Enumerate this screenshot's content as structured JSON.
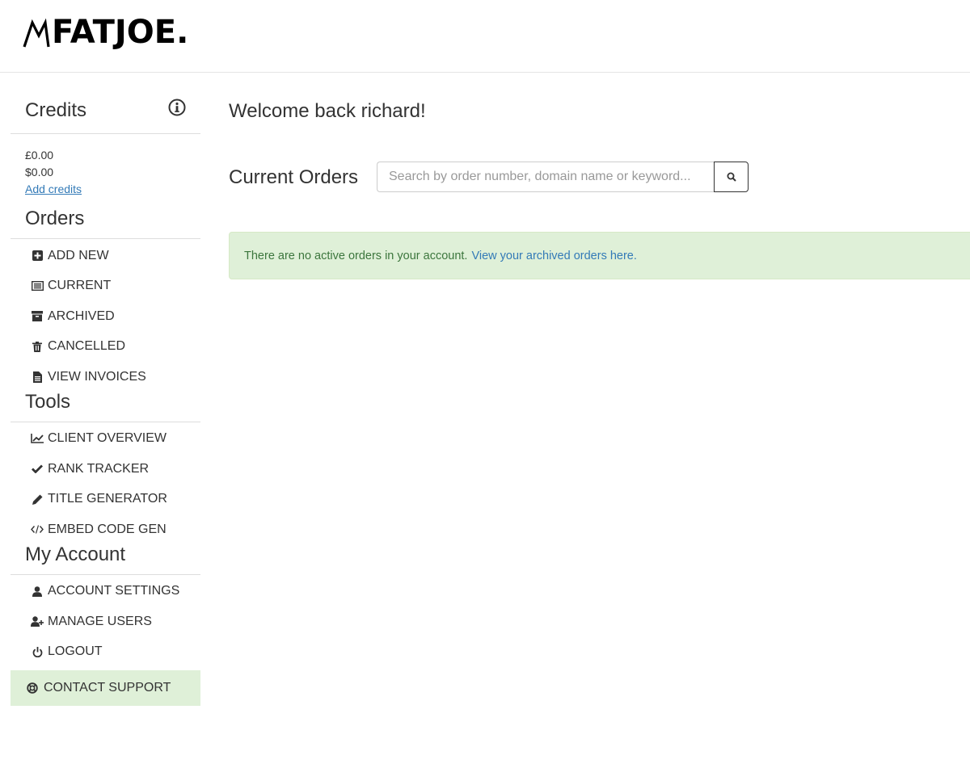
{
  "brand": {
    "logo_text": "FATJOE."
  },
  "credits": {
    "title": "Credits",
    "info_icon": "info-circle-icon",
    "gbp": "£0.00",
    "usd": "$0.00",
    "add_link": "Add credits"
  },
  "orders": {
    "title": "Orders",
    "items": [
      {
        "label": "ADD NEW",
        "icon": "plus-square-icon"
      },
      {
        "label": "CURRENT",
        "icon": "list-alt-icon"
      },
      {
        "label": "ARCHIVED",
        "icon": "archive-icon"
      },
      {
        "label": "CANCELLED",
        "icon": "trash-icon"
      },
      {
        "label": "VIEW INVOICES",
        "icon": "file-text-icon"
      }
    ]
  },
  "tools": {
    "title": "Tools",
    "items": [
      {
        "label": "CLIENT OVERVIEW",
        "icon": "line-chart-icon"
      },
      {
        "label": "RANK TRACKER",
        "icon": "check-icon"
      },
      {
        "label": "TITLE GENERATOR",
        "icon": "pencil-icon"
      },
      {
        "label": "EMBED CODE GEN",
        "icon": "code-icon"
      }
    ]
  },
  "account": {
    "title": "My Account",
    "items": [
      {
        "label": "ACCOUNT SETTINGS",
        "icon": "user-icon"
      },
      {
        "label": "MANAGE USERS",
        "icon": "user-plus-icon"
      },
      {
        "label": "LOGOUT",
        "icon": "power-off-icon"
      }
    ]
  },
  "support": {
    "label": "CONTACT SUPPORT",
    "icon": "life-ring-icon"
  },
  "main": {
    "welcome": "Welcome back richard!",
    "orders_title": "Current Orders",
    "search_placeholder": "Search by order number, domain name or keyword...",
    "search_icon": "search-icon",
    "alert_text": "There are no active orders in your account.",
    "alert_link": "View your archived orders here."
  },
  "colors": {
    "accent_link": "#337ab7",
    "success_bg": "#dff0d8",
    "success_text": "#3c763d"
  }
}
